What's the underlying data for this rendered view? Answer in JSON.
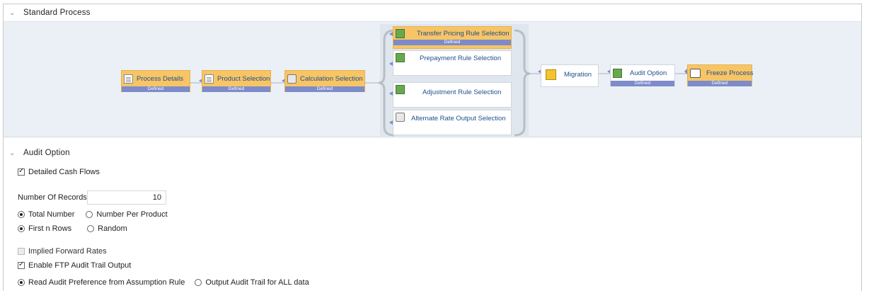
{
  "sections": {
    "standard_process": "Standard Process",
    "audit_option": "Audit Option"
  },
  "flow": {
    "nodes": [
      {
        "id": "process-details",
        "label": "Process Details",
        "status": "Defined",
        "icon": "document-icon"
      },
      {
        "id": "product-selection",
        "label": "Product Selection",
        "status": "Defined",
        "icon": "document-icon"
      },
      {
        "id": "calculation-selection",
        "label": "Calculation Selection",
        "status": "Defined",
        "icon": "calculator-icon"
      },
      {
        "id": "transfer-pricing",
        "label": "Transfer Pricing Rule Selection",
        "status": "Defined",
        "icon": "rule-icon"
      },
      {
        "id": "prepayment",
        "label": "Prepayment Rule Selection",
        "status": "",
        "icon": "prepayment-icon"
      },
      {
        "id": "adjustment",
        "label": "Adjustment Rule Selection",
        "status": "",
        "icon": "adjustment-icon"
      },
      {
        "id": "alternate-rate",
        "label": "Alternate Rate Output Selection",
        "status": "",
        "icon": "gear-icon"
      },
      {
        "id": "migration",
        "label": "Migration",
        "status": "",
        "icon": "migration-icon"
      },
      {
        "id": "audit-option",
        "label": "Audit Option",
        "status": "Defined",
        "icon": "audit-icon"
      },
      {
        "id": "freeze-process",
        "label": "Freeze Process",
        "status": "Defined",
        "icon": "freeze-icon"
      }
    ]
  },
  "audit": {
    "detailed_cash_flows": {
      "label": "Detailed Cash Flows",
      "checked": true
    },
    "number_of_records": {
      "label": "Number Of Records",
      "value": "10"
    },
    "record_scope": {
      "option_a": "Total Number",
      "option_b": "Number Per Product",
      "selected": "Total Number"
    },
    "record_order": {
      "option_a": "First n Rows",
      "option_b": "Random",
      "selected": "First n Rows"
    },
    "implied_forward_rates": {
      "label": "Implied Forward Rates",
      "checked": false,
      "disabled": true
    },
    "enable_ftp_audit": {
      "label": "Enable FTP Audit Trail Output",
      "checked": true
    },
    "audit_source": {
      "option_a": "Read Audit Preference from Assumption Rule",
      "option_b": "Output Audit Trail for ALL data",
      "selected": "Read Audit Preference from Assumption Rule"
    }
  },
  "colors": {
    "node_yellow": "#f7c565",
    "status_bar": "#7e8bc9",
    "flow_bg": "#eaf0f6",
    "link_text": "#1f4e8c"
  }
}
